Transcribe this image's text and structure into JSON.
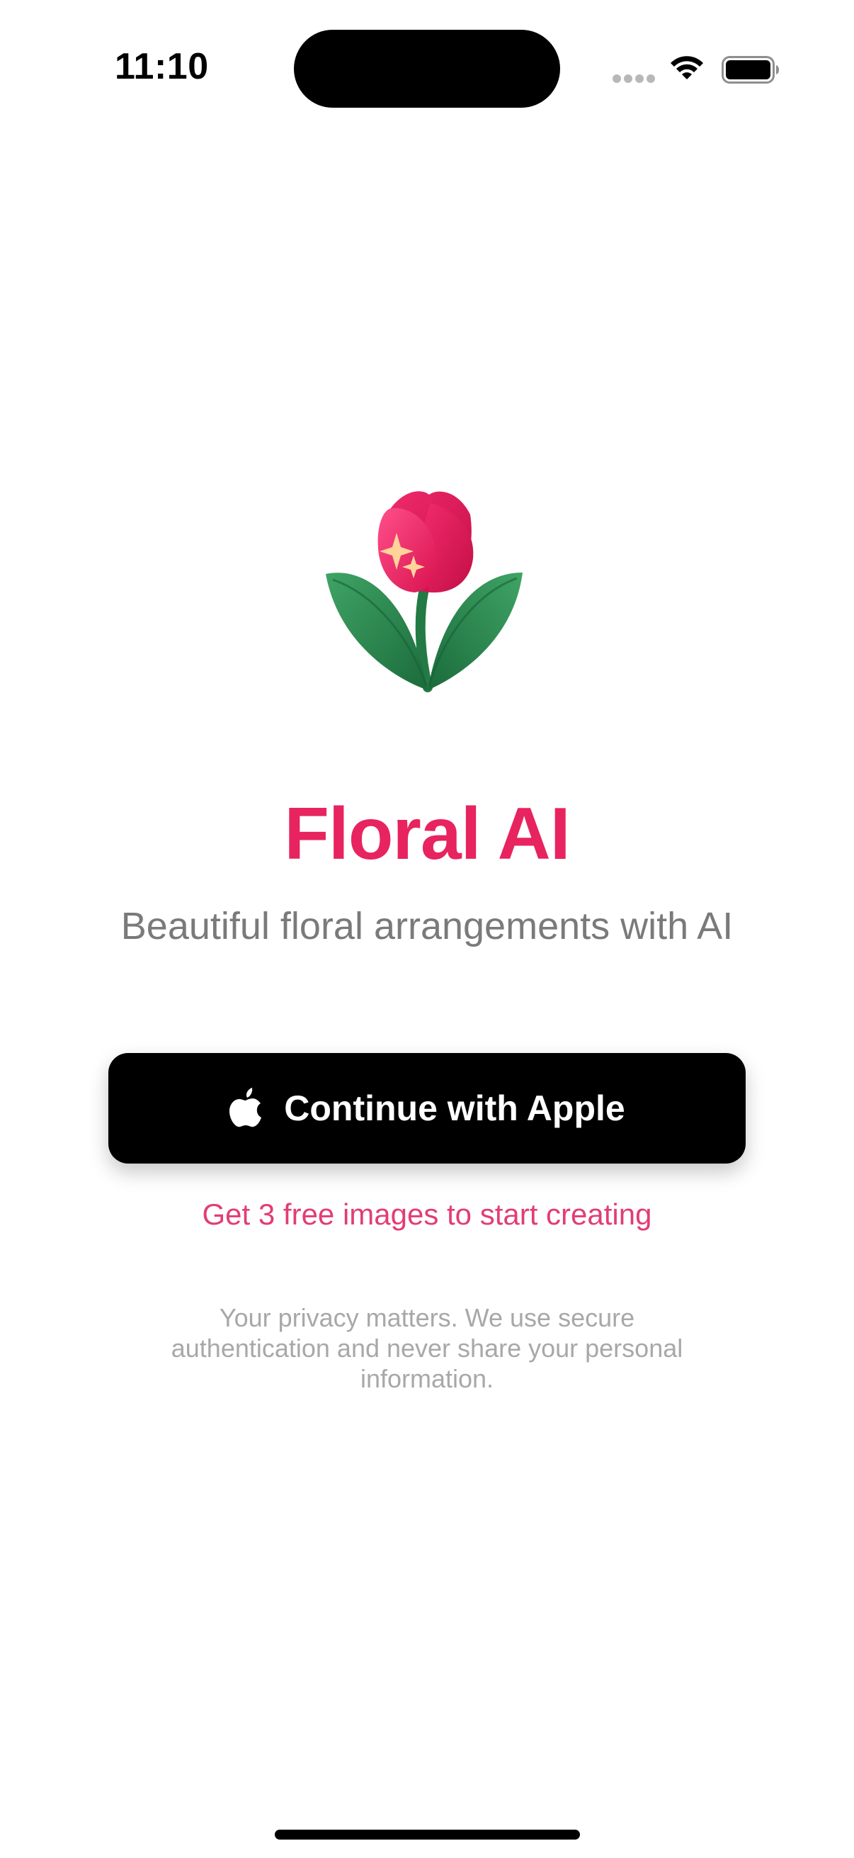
{
  "status_bar": {
    "time": "11:10",
    "icons": [
      "cellular-signal-icon",
      "wifi-icon",
      "battery-icon"
    ]
  },
  "app": {
    "title": "Floral AI",
    "subtitle": "Beautiful floral arrangements with AI",
    "logo_icon": "tulip-sparkle-icon"
  },
  "auth": {
    "apple_button_label": "Continue with Apple",
    "apple_icon": "apple-logo-icon",
    "free_offer": "Get 3 free images to start creating",
    "privacy_note": "Your privacy matters. We use secure authentication and never share your personal information."
  },
  "colors": {
    "brand": "#e7245f",
    "link": "#e23d74",
    "button_bg": "#000000",
    "subtitle": "#7a7a7a",
    "privacy": "#a8a8a8"
  }
}
